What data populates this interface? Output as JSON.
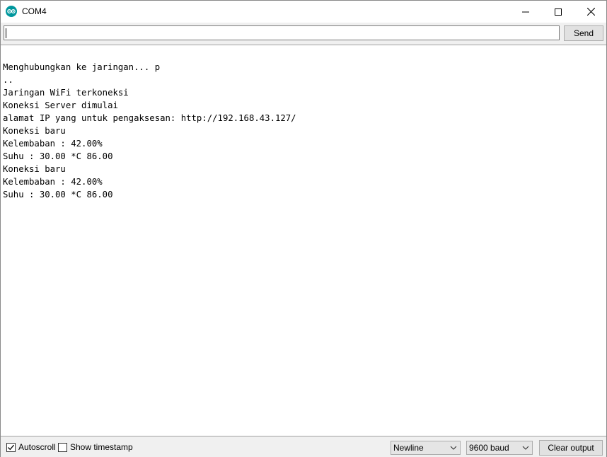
{
  "window": {
    "title": "COM4",
    "icon": "arduino-icon",
    "controls": [
      "minimize-icon",
      "maximize-icon",
      "close-icon"
    ]
  },
  "input": {
    "value": "",
    "send_label": "Send"
  },
  "output": {
    "lines": [
      "Menghubungkan ke jaringan... p",
      "..",
      "Jaringan WiFi terkoneksi",
      "Koneksi Server dimulai",
      "alamat IP yang untuk pengaksesan: http://192.168.43.127/",
      "Koneksi baru",
      "Kelembaban : 42.00%",
      "Suhu : 30.00 *C 86.00",
      "Koneksi baru",
      "Kelembaban : 42.00%",
      "Suhu : 30.00 *C 86.00"
    ]
  },
  "statusbar": {
    "autoscroll_label": "Autoscroll",
    "autoscroll_checked": true,
    "timestamp_label": "Show timestamp",
    "timestamp_checked": false,
    "line_ending": "Newline",
    "baud_rate": "9600 baud",
    "clear_label": "Clear output"
  },
  "colors": {
    "arduino_teal": "#00979d",
    "bar_background": "#f0f0f0",
    "button_face": "#e1e1e1"
  }
}
